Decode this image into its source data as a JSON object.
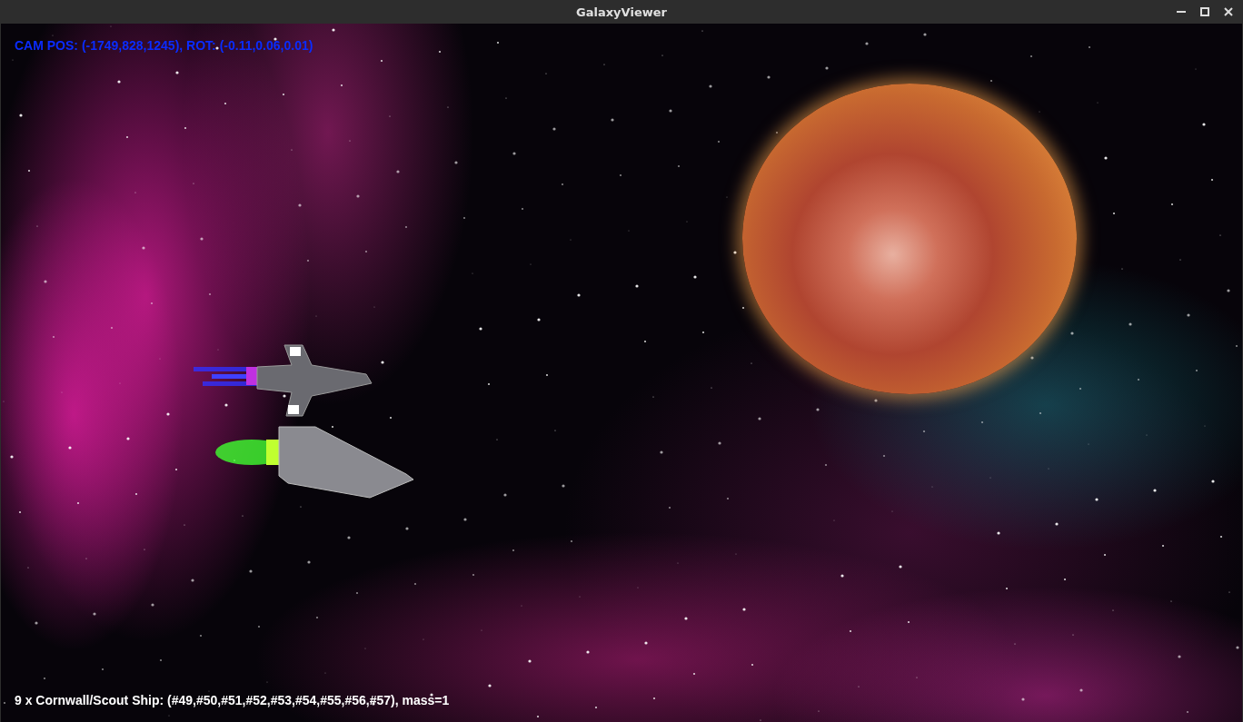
{
  "window": {
    "title": "GalaxyViewer"
  },
  "hud": {
    "camera": "CAM POS: (-1749,828,1245), ROT: (-0.11,0.06,0.01)",
    "selection": "9 x Cornwall/Scout Ship: (#49,#50,#51,#52,#53,#54,#55,#56,#57), mass=1"
  }
}
